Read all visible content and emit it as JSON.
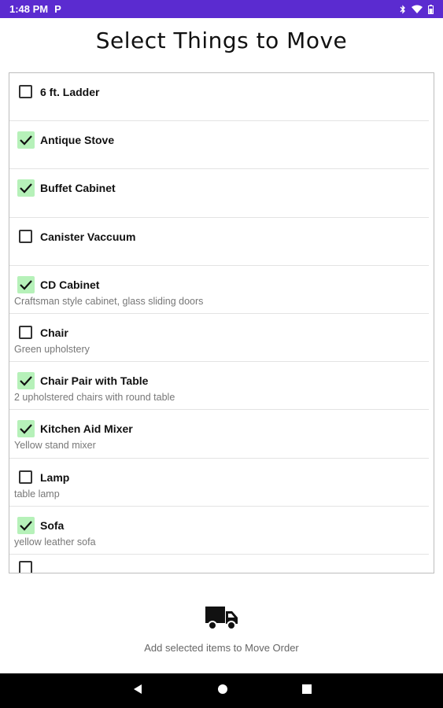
{
  "status": {
    "time": "1:48 PM",
    "app_letter": "P"
  },
  "title": "Select Things to Move",
  "items": [
    {
      "name": "6 ft. Ladder",
      "description": "",
      "checked": false
    },
    {
      "name": "Antique Stove",
      "description": "",
      "checked": true
    },
    {
      "name": "Buffet Cabinet",
      "description": "",
      "checked": true
    },
    {
      "name": "Canister Vaccuum",
      "description": "",
      "checked": false
    },
    {
      "name": "CD Cabinet",
      "description": "Craftsman style cabinet, glass sliding doors",
      "checked": true
    },
    {
      "name": "Chair",
      "description": "Green upholstery",
      "checked": false
    },
    {
      "name": "Chair Pair with Table",
      "description": "2 upholstered chairs with round table",
      "checked": true
    },
    {
      "name": "Kitchen Aid Mixer",
      "description": "Yellow stand mixer",
      "checked": true
    },
    {
      "name": "Lamp",
      "description": "table lamp",
      "checked": false
    },
    {
      "name": "Sofa",
      "description": "yellow leather sofa",
      "checked": true
    }
  ],
  "action": {
    "label": "Add selected items to Move Order",
    "icon": "truck-icon"
  },
  "colors": {
    "status_bar": "#5b2bd0",
    "check_fill": "#b6f1b9",
    "nav_bar": "#000000"
  }
}
